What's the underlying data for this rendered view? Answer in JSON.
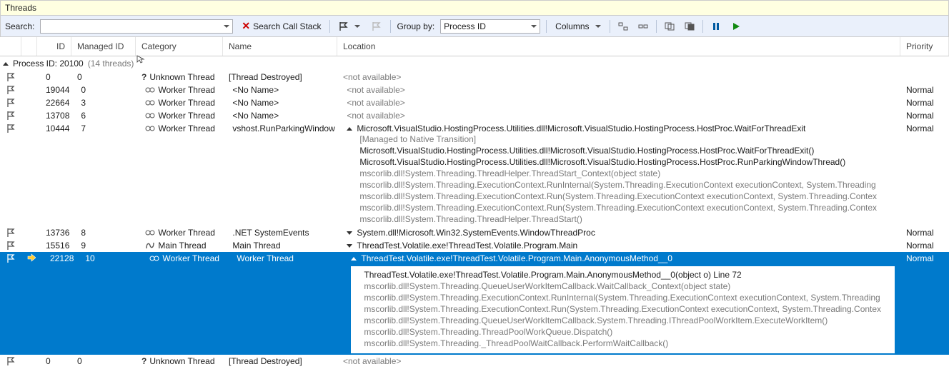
{
  "window": {
    "title": "Threads"
  },
  "toolbar": {
    "search_label": "Search:",
    "search_value": "",
    "search_stack_label": "Search Call Stack",
    "group_by_label": "Group by:",
    "group_by_value": "Process ID",
    "columns_label": "Columns"
  },
  "columns": {
    "id": "ID",
    "managed_id": "Managed ID",
    "category": "Category",
    "name": "Name",
    "location": "Location",
    "priority": "Priority"
  },
  "group": {
    "label": "Process ID: 20100",
    "count_label": "(14 threads)"
  },
  "rows": [
    {
      "id": "0",
      "mid": "0",
      "cat": "Unknown Thread",
      "cat_icon": "question-icon",
      "name": "[Thread Destroyed]",
      "loc_simple": "<not available>",
      "priority": ""
    },
    {
      "id": "19044",
      "mid": "0",
      "cat": "Worker Thread",
      "cat_icon": "gear-icon",
      "name": "<No Name>",
      "loc_simple": "<not available>",
      "priority": "Normal"
    },
    {
      "id": "22664",
      "mid": "3",
      "cat": "Worker Thread",
      "cat_icon": "gear-icon",
      "name": "<No Name>",
      "loc_simple": "<not available>",
      "priority": "Normal"
    },
    {
      "id": "13708",
      "mid": "6",
      "cat": "Worker Thread",
      "cat_icon": "gear-icon",
      "name": "<No Name>",
      "loc_simple": "<not available>",
      "priority": "Normal"
    },
    {
      "id": "10444",
      "mid": "7",
      "cat": "Worker Thread",
      "cat_icon": "gear-icon",
      "name": "vshost.RunParkingWindow",
      "loc_expanded": {
        "top": "Microsoft.VisualStudio.HostingProcess.Utilities.dll!Microsoft.VisualStudio.HostingProcess.HostProc.WaitForThreadExit",
        "lines": [
          {
            "text": "[Managed to Native Transition]",
            "strong": false
          },
          {
            "text": "Microsoft.VisualStudio.HostingProcess.Utilities.dll!Microsoft.VisualStudio.HostingProcess.HostProc.WaitForThreadExit()",
            "strong": true
          },
          {
            "text": "Microsoft.VisualStudio.HostingProcess.Utilities.dll!Microsoft.VisualStudio.HostingProcess.HostProc.RunParkingWindowThread()",
            "strong": true
          },
          {
            "text": "mscorlib.dll!System.Threading.ThreadHelper.ThreadStart_Context(object state)",
            "strong": false
          },
          {
            "text": "mscorlib.dll!System.Threading.ExecutionContext.RunInternal(System.Threading.ExecutionContext executionContext, System.Threading",
            "strong": false
          },
          {
            "text": "mscorlib.dll!System.Threading.ExecutionContext.Run(System.Threading.ExecutionContext executionContext, System.Threading.Contex",
            "strong": false
          },
          {
            "text": "mscorlib.dll!System.Threading.ExecutionContext.Run(System.Threading.ExecutionContext executionContext, System.Threading.Contex",
            "strong": false
          },
          {
            "text": "mscorlib.dll!System.Threading.ThreadHelper.ThreadStart()",
            "strong": false
          }
        ]
      },
      "priority": "Normal"
    },
    {
      "id": "13736",
      "mid": "8",
      "cat": "Worker Thread",
      "cat_icon": "gear-icon",
      "name": ".NET SystemEvents",
      "loc_collapsed": "System.dll!Microsoft.Win32.SystemEvents.WindowThreadProc",
      "priority": "Normal"
    },
    {
      "id": "15516",
      "mid": "9",
      "cat": "Main Thread",
      "cat_icon": "main-icon",
      "name": "Main Thread",
      "loc_collapsed": "ThreadTest.Volatile.exe!ThreadTest.Volatile.Program.Main",
      "priority": "Normal"
    },
    {
      "id": "22128",
      "mid": "10",
      "cat": "Worker Thread",
      "cat_icon": "gear-icon",
      "name": "Worker Thread",
      "selected": true,
      "break": true,
      "loc_expanded": {
        "top": "ThreadTest.Volatile.exe!ThreadTest.Volatile.Program.Main.AnonymousMethod__0",
        "lines": [
          {
            "text": "ThreadTest.Volatile.exe!ThreadTest.Volatile.Program.Main.AnonymousMethod__0(object o) Line 72",
            "strong": true
          },
          {
            "text": "mscorlib.dll!System.Threading.QueueUserWorkItemCallback.WaitCallback_Context(object state)",
            "strong": false
          },
          {
            "text": "mscorlib.dll!System.Threading.ExecutionContext.RunInternal(System.Threading.ExecutionContext executionContext, System.Threading",
            "strong": false
          },
          {
            "text": "mscorlib.dll!System.Threading.ExecutionContext.Run(System.Threading.ExecutionContext executionContext, System.Threading.Contex",
            "strong": false
          },
          {
            "text": "mscorlib.dll!System.Threading.QueueUserWorkItemCallback.System.Threading.IThreadPoolWorkItem.ExecuteWorkItem()",
            "strong": false
          },
          {
            "text": "mscorlib.dll!System.Threading.ThreadPoolWorkQueue.Dispatch()",
            "strong": false
          },
          {
            "text": "mscorlib.dll!System.Threading._ThreadPoolWaitCallback.PerformWaitCallback()",
            "strong": false
          }
        ]
      },
      "priority": "Normal"
    },
    {
      "id": "0",
      "mid": "0",
      "cat": "Unknown Thread",
      "cat_icon": "question-icon",
      "name": "[Thread Destroyed]",
      "loc_simple": "<not available>",
      "priority": ""
    }
  ]
}
